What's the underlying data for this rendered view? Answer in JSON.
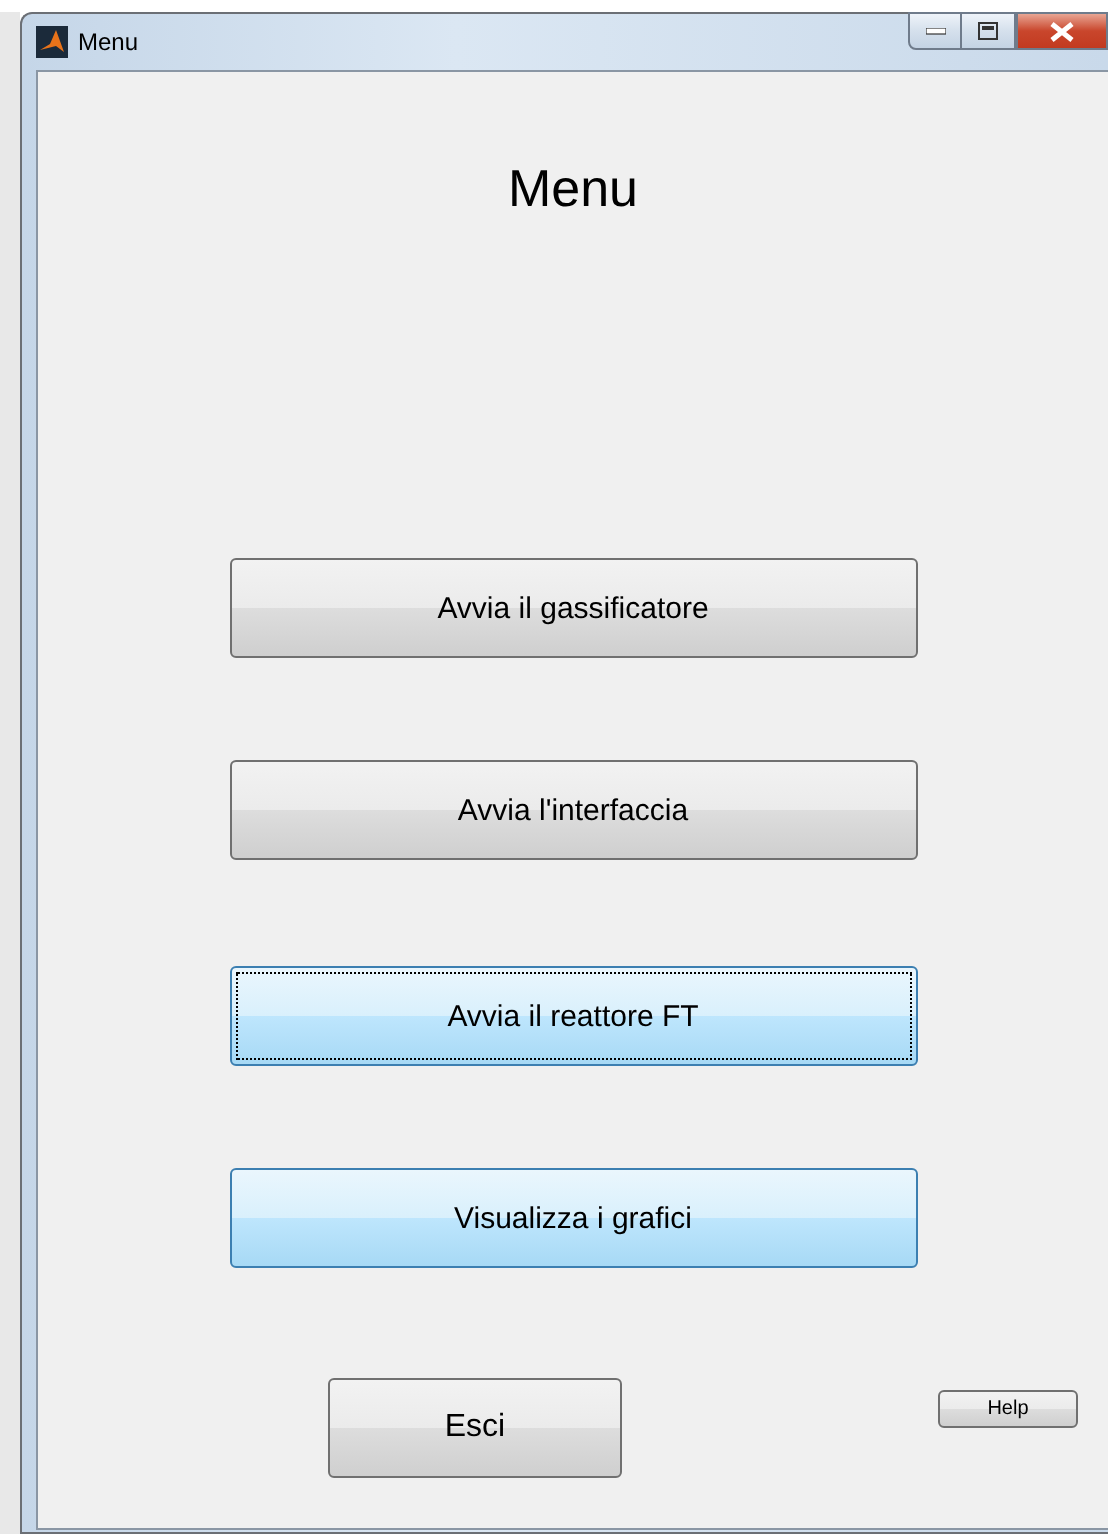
{
  "window": {
    "title": "Menu"
  },
  "heading": "Menu",
  "buttons": [
    {
      "label": "Avvia il gassificatore",
      "highlighted": false,
      "focused": false
    },
    {
      "label": "Avvia l'interfaccia",
      "highlighted": false,
      "focused": false
    },
    {
      "label": "Avvia il reattore FT",
      "highlighted": true,
      "focused": true
    },
    {
      "label": "Visualizza i grafici",
      "highlighted": true,
      "focused": false
    }
  ],
  "exit_button": "Esci",
  "help_button": "Help"
}
